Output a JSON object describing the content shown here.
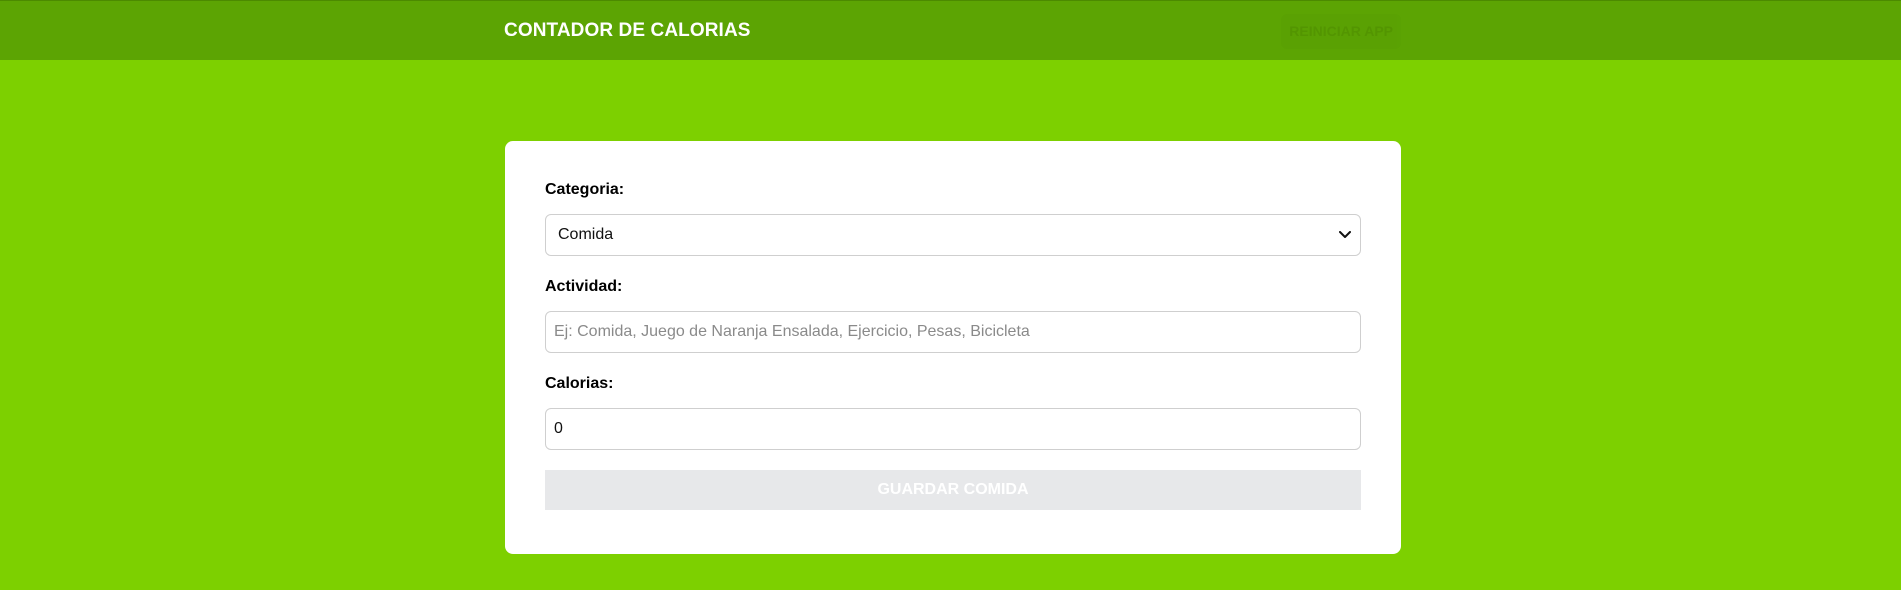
{
  "header": {
    "title": "CONTADOR DE CALORIAS",
    "reset_label": "REINICIAR APP"
  },
  "form": {
    "category": {
      "label": "Categoria:",
      "selected": "Comida"
    },
    "activity": {
      "label": "Actividad:",
      "value": "",
      "placeholder": "Ej: Comida, Juego de Naranja Ensalada, Ejercicio, Pesas, Bicicleta"
    },
    "calories": {
      "label": "Calorias:",
      "value": "0"
    },
    "submit_label": "GUARDAR COMIDA"
  },
  "colors": {
    "page_background": "#7dd000",
    "header_background": "#5ca403",
    "card_background": "#ffffff",
    "button_disabled": "#e7e8ea"
  },
  "icons": {
    "select_chevron": "chevron-down-icon"
  }
}
